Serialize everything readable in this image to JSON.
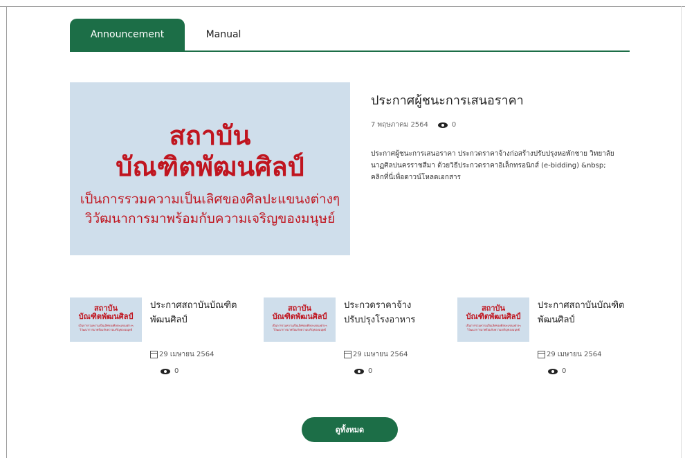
{
  "tabs": [
    {
      "label": "Announcement",
      "active": true
    },
    {
      "label": "Manual",
      "active": false
    }
  ],
  "image_text": {
    "title_line1": "สถาบัน",
    "title_line2": "บัณฑิตพัฒนศิลป์",
    "sub_line1": "เป็นการรวมความเป็นเลิศของศิลปะแขนงต่างๆ",
    "sub_line2": "วิวัฒนาการมาพร้อมกับความเจริญของมนุษย์"
  },
  "featured": {
    "title": "ประกาศผู้ชนะการเสนอราคา",
    "date": "7 พฤษภาคม 2564",
    "views": "0",
    "description": "ประกาศผู้ชนะการเสนอราคา ประกวดราคาจ้างก่อสร้างปรับปรุงหอพักชาย วิทยาลัยนาฏศิลปนครราชสีมา ด้วยวิธีประกวดราคาอิเล็กทรอนิกส์ (e-bidding) &nbsp; คลิกที่นี่เพื่อดาวน์โหลดเอกสาร"
  },
  "cards": [
    {
      "title": "ประกาศสถาบันบัณฑิตพัฒนศิลป์",
      "date": "29 เมษายน 2564",
      "views": "0"
    },
    {
      "title": "ประกวดราคาจ้างปรับปรุงโรงอาหาร",
      "date": "29 เมษายน 2564",
      "views": "0"
    },
    {
      "title": "ประกาศสถาบันบัณฑิตพัฒนศิลป์",
      "date": "29 เมษายน 2564",
      "views": "0"
    }
  ],
  "view_all_label": "ดูทั้งหมด",
  "colors": {
    "accent": "#1c6e47",
    "brand_red": "#c0151f",
    "image_bg": "#cfdeeb"
  }
}
